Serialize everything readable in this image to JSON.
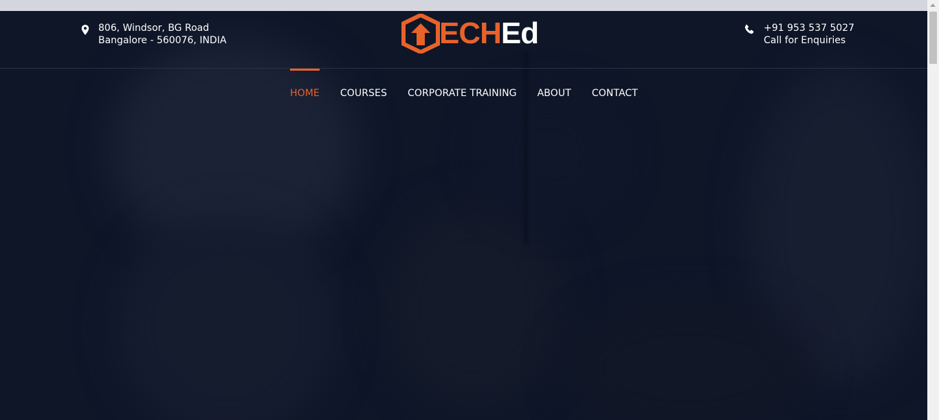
{
  "header": {
    "address": {
      "icon": "map-pin-icon",
      "line1": "806, Windsor, BG Road",
      "line2": "Bangalore - 560076, INDIA"
    },
    "logo": {
      "text_accent": "ECH",
      "text_main": "Ed"
    },
    "contact": {
      "icon": "phone-icon",
      "phone": "+91 953 537 5027",
      "caption": "Call for Enquiries"
    }
  },
  "nav": {
    "items": [
      {
        "label": "HOME",
        "active": true
      },
      {
        "label": "COURSES",
        "active": false
      },
      {
        "label": "CORPORATE TRAINING",
        "active": false
      },
      {
        "label": "ABOUT",
        "active": false
      },
      {
        "label": "CONTACT",
        "active": false
      }
    ]
  },
  "colors": {
    "accent": "#e8622a",
    "background": "#0e1628",
    "text": "#ffffff"
  }
}
